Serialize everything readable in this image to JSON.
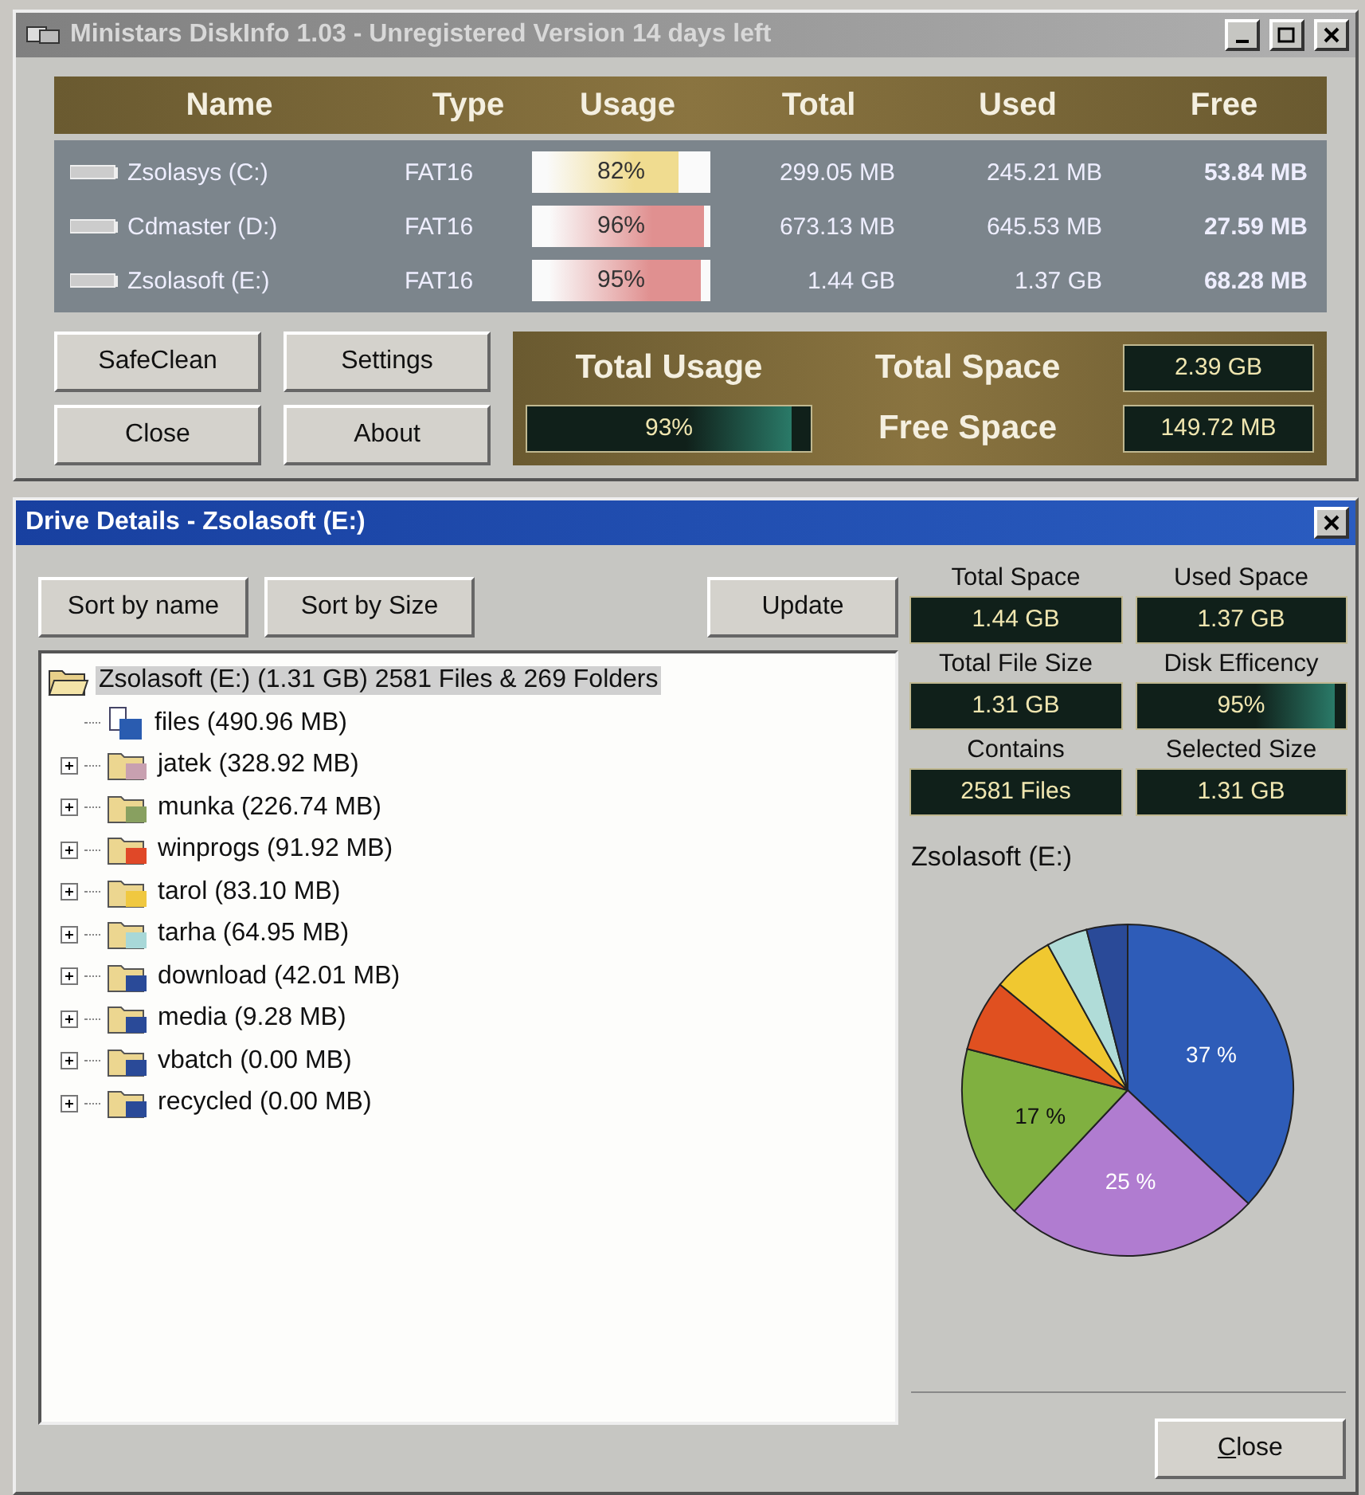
{
  "main_window": {
    "title": "Ministars DiskInfo 1.03 - Unregistered Version 14 days left",
    "active": false
  },
  "drives": {
    "columns": [
      "Name",
      "Type",
      "Usage",
      "Total",
      "Used",
      "Free"
    ],
    "rows": [
      {
        "name": "Zsolasys (C:)",
        "type": "FAT16",
        "usage": "82%",
        "level": 0.82,
        "color": "#f0dc90",
        "total": "299.05 MB",
        "used": "245.21 MB",
        "free": "53.84 MB"
      },
      {
        "name": "Cdmaster (D:)",
        "type": "FAT16",
        "usage": "96%",
        "level": 0.96,
        "color": "#e09090",
        "total": "673.13 MB",
        "used": "645.53 MB",
        "free": "27.59 MB"
      },
      {
        "name": "Zsolasoft (E:)",
        "type": "FAT16",
        "usage": "95%",
        "level": 0.95,
        "color": "#e09090",
        "total": "1.44 GB",
        "used": "1.37 GB",
        "free": "68.28 MB"
      }
    ]
  },
  "buttons": [
    "SafeClean",
    "Settings",
    "Close",
    "About"
  ],
  "summary": {
    "total_usage_label": "Total Usage",
    "total_usage": "93%",
    "level": 0.93,
    "total_space_label": "Total Space",
    "total_space": "2.39 GB",
    "free_space_label": "Free Space",
    "free_space": "149.72 MB"
  },
  "details_window": {
    "title": "Drive Details - Zsolasoft (E:)",
    "active": true
  },
  "detail_buttons": [
    "Sort by name",
    "Sort by Size",
    "Update"
  ],
  "tree": {
    "label": "Zsolasoft (E:)  (1.31 GB) 2581 Files & 269 Folders",
    "selected": true,
    "expanded": true,
    "children": [
      {
        "label": "files  (490.96 MB)",
        "kind": "files",
        "color": "#2a5cb0",
        "selected": false
      },
      {
        "label": "jatek  (328.92 MB)",
        "kind": "folder",
        "color": "#c8a0b0",
        "selected": false,
        "expanded": false
      },
      {
        "label": "munka  (226.74 MB)",
        "kind": "folder",
        "color": "#88a060",
        "selected": false,
        "expanded": false
      },
      {
        "label": "winprogs  (91.92 MB)",
        "kind": "folder",
        "color": "#e04828",
        "selected": false,
        "expanded": false
      },
      {
        "label": "tarol  (83.10 MB)",
        "kind": "folder",
        "color": "#f0c840",
        "selected": false,
        "expanded": false
      },
      {
        "label": "tarha  (64.95 MB)",
        "kind": "folder",
        "color": "#a8d8d8",
        "selected": false,
        "expanded": false
      },
      {
        "label": "download  (42.01 MB)",
        "kind": "folder",
        "color": "#2a4a98",
        "selected": false,
        "expanded": false
      },
      {
        "label": "media  (9.28 MB)",
        "kind": "folder",
        "color": "#2a4a98",
        "selected": false,
        "expanded": false
      },
      {
        "label": "vbatch  (0.00 MB)",
        "kind": "folder",
        "color": "#2a4a98",
        "selected": false,
        "expanded": false
      },
      {
        "label": "recycled  (0.00 MB)",
        "kind": "folder",
        "color": "#2a4a98",
        "selected": false,
        "expanded": false
      }
    ]
  },
  "stats": [
    {
      "label": "Total Space",
      "value": "1.44 GB",
      "kind": "text"
    },
    {
      "label": "Used Space",
      "value": "1.37 GB",
      "kind": "text"
    },
    {
      "label": "Total File Size",
      "value": "1.31 GB",
      "kind": "text"
    },
    {
      "label": "Disk Efficency",
      "value": "95%",
      "kind": "meter",
      "level": 0.95
    },
    {
      "label": "Contains",
      "value": "2581 Files",
      "kind": "text"
    },
    {
      "label": "Selected Size",
      "value": "1.31 GB",
      "kind": "text"
    }
  ],
  "chart_title": "Zsolasoft (E:)",
  "chart_data": {
    "type": "pie",
    "values": [
      37,
      25,
      17,
      7,
      6,
      4,
      4
    ],
    "colors": [
      "#2e5cb8",
      "#b07cd0",
      "#80b040",
      "#e05020",
      "#f0c830",
      "#b0dcd8",
      "#2a4a98"
    ],
    "value_labels": [
      "37 %",
      "25 %",
      "17 %",
      null,
      null,
      null,
      null
    ]
  },
  "close_button": "Close"
}
